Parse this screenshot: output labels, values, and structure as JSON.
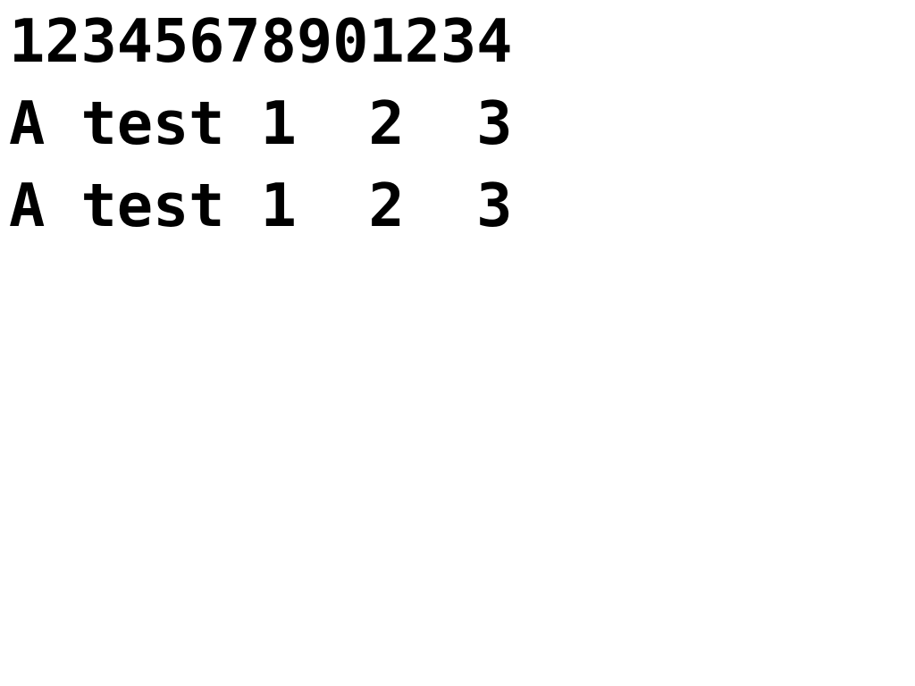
{
  "lines": [
    "12345678901234",
    "A test 1  2  3",
    "A test 1  2  3"
  ],
  "colors": {
    "background": "#ffffff",
    "text": "#000000"
  }
}
